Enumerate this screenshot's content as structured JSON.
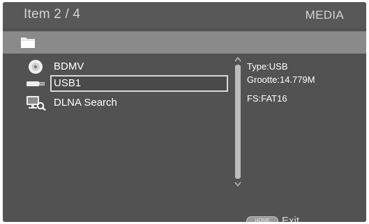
{
  "header": {
    "item_position": "Item 2 / 4",
    "section_title": "MEDIA"
  },
  "path_bar": {
    "icon": "folder-icon"
  },
  "list": {
    "items": [
      {
        "label": "BDMV",
        "icon": "disc-icon",
        "selected": false
      },
      {
        "label": "USB1",
        "icon": "usb-icon",
        "selected": true
      },
      {
        "label": "DLNA Search",
        "icon": "dlna-search-icon",
        "selected": false
      }
    ]
  },
  "details": {
    "type": "Type:USB",
    "size": "Grootte:14.779M",
    "filesystem": "FS:FAT16"
  },
  "footer": {
    "home_button": "HOME",
    "exit_label": "Exit"
  },
  "colors": {
    "background": "#525252",
    "header": "#585858",
    "path_bar": "#8a8a8a",
    "selection_border": "#dadada",
    "text": "#ffffff"
  }
}
